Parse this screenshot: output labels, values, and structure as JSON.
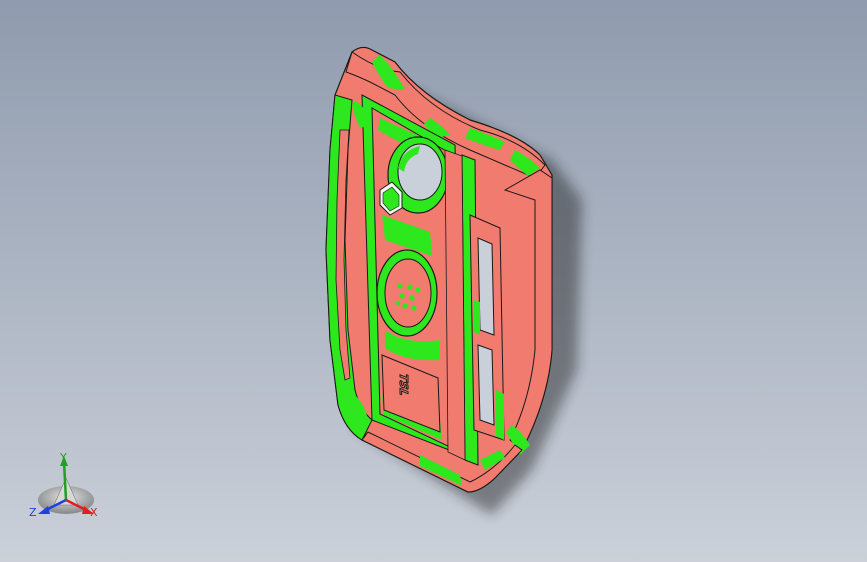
{
  "viewport": {
    "background_top": "#8f9bae",
    "background_bottom": "#cbd0d9"
  },
  "model": {
    "name": "",
    "surface_color_a": "#f07b6e",
    "surface_color_b": "#2ee81e",
    "edge_color": "#1a1a1a",
    "embossed_text": "TSL"
  },
  "triad": {
    "x_label": "X",
    "y_label": "Y",
    "z_label": "Z",
    "x_color": "#e02020",
    "y_color": "#20a020",
    "z_color": "#2040e0"
  }
}
